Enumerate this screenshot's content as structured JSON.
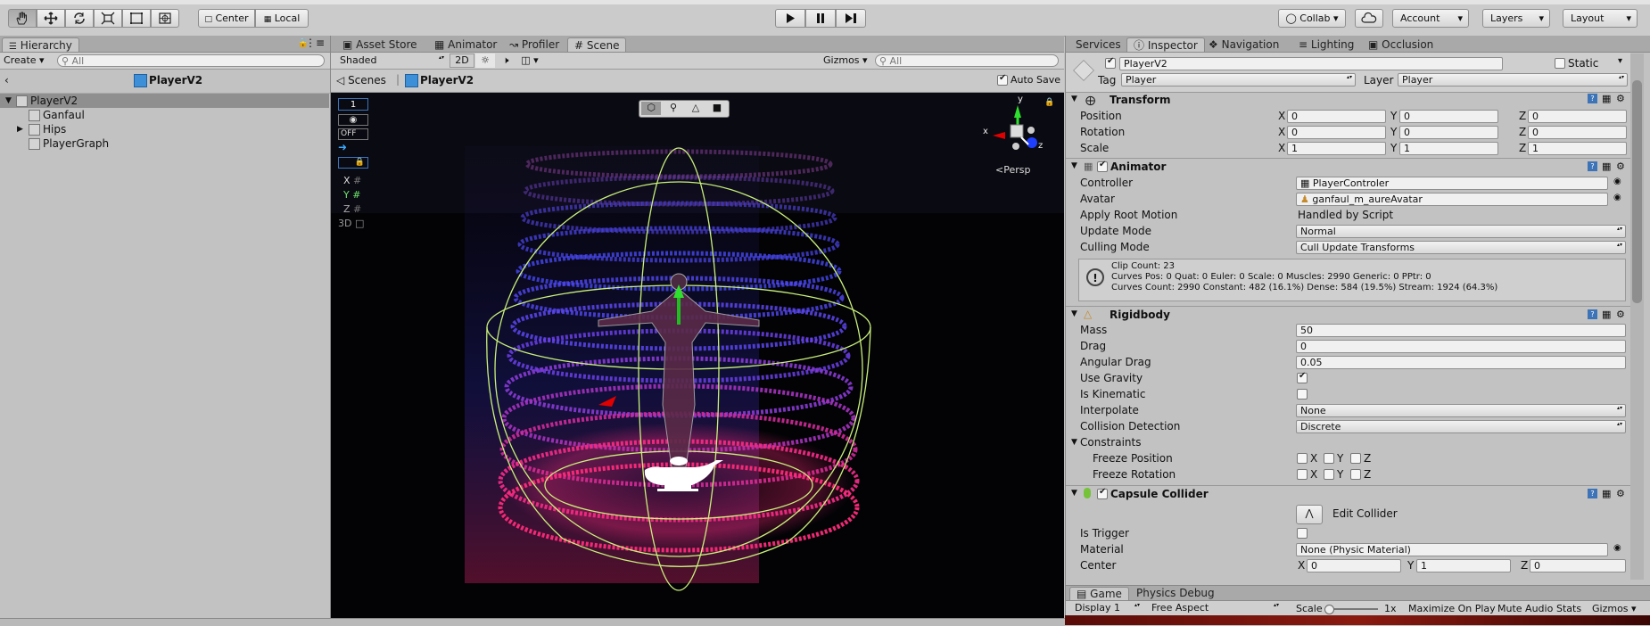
{
  "toolbar": {
    "pivot_label": "Center",
    "space_label": "Local",
    "collab_label": "Collab",
    "account_label": "Account",
    "layers_label": "Layers",
    "layout_label": "Layout"
  },
  "hierarchy": {
    "tab_label": "Hierarchy",
    "create_label": "Create",
    "search_placeholder": " All",
    "scene_title": "PlayerV2",
    "items": [
      {
        "label": "PlayerV2",
        "depth": 0,
        "selected": true,
        "expanded": true
      },
      {
        "label": "Ganfaul",
        "depth": 1
      },
      {
        "label": "Hips",
        "depth": 1,
        "collapsed": true
      },
      {
        "label": "PlayerGraph",
        "depth": 1
      }
    ]
  },
  "scene": {
    "tabs": [
      "Asset Store",
      "Animator",
      "Profiler",
      "Scene"
    ],
    "active_tab": "Scene",
    "shading_mode": "Shaded",
    "mode_2d": "2D",
    "gizmos_label": "Gizmos",
    "search_placeholder": " All",
    "breadcrumb_scenes": "Scenes",
    "breadcrumb_prefab": "PlayerV2",
    "auto_save_label": "Auto Save",
    "auto_save_checked": true,
    "layer_field": "1",
    "off_label": "OFF",
    "axis_x": "X",
    "axis_y": "Y",
    "axis_z": "Z",
    "label_3d": "3D",
    "persp_label": "Persp",
    "gizmo_y": "y",
    "gizmo_x": "x",
    "gizmo_z": "z"
  },
  "inspector": {
    "tabs": [
      "Services",
      "Inspector",
      "Navigation",
      "Lighting",
      "Occlusion"
    ],
    "active_tab": "Inspector",
    "object_name": "PlayerV2",
    "static_label": "Static",
    "tag_label": "Tag",
    "tag_value": "Player",
    "layer_label": "Layer",
    "layer_value": "Player",
    "transform": {
      "title": "Transform",
      "position_label": "Position",
      "rotation_label": "Rotation",
      "scale_label": "Scale",
      "position": {
        "x": "0",
        "y": "0",
        "z": "0"
      },
      "rotation": {
        "x": "0",
        "y": "0",
        "z": "0"
      },
      "scale": {
        "x": "1",
        "y": "1",
        "z": "1"
      }
    },
    "animator": {
      "title": "Animator",
      "controller_label": "Controller",
      "controller_value": "PlayerControler",
      "avatar_label": "Avatar",
      "avatar_value": "ganfaul_m_aureAvatar",
      "apply_root_motion_label": "Apply Root Motion",
      "apply_root_motion_value": "Handled by Script",
      "update_mode_label": "Update Mode",
      "update_mode_value": "Normal",
      "culling_mode_label": "Culling Mode",
      "culling_mode_value": "Cull Update Transforms",
      "info_line1": "Clip Count: 23",
      "info_line2": "Curves Pos: 0 Quat: 0 Euler: 0 Scale: 0 Muscles: 2990 Generic: 0 PPtr: 0",
      "info_line3": "Curves Count: 2990 Constant: 482 (16.1%) Dense: 584 (19.5%) Stream: 1924 (64.3%)"
    },
    "rigidbody": {
      "title": "Rigidbody",
      "mass_label": "Mass",
      "mass_value": "50",
      "drag_label": "Drag",
      "drag_value": "0",
      "angular_drag_label": "Angular Drag",
      "angular_drag_value": "0.05",
      "use_gravity_label": "Use Gravity",
      "use_gravity": true,
      "is_kinematic_label": "Is Kinematic",
      "is_kinematic": false,
      "interpolate_label": "Interpolate",
      "interpolate_value": "None",
      "collision_detection_label": "Collision Detection",
      "collision_detection_value": "Discrete",
      "constraints_label": "Constraints",
      "freeze_position_label": "Freeze Position",
      "freeze_rotation_label": "Freeze Rotation"
    },
    "capsule_collider": {
      "title": "Capsule Collider",
      "edit_collider_label": "Edit Collider",
      "is_trigger_label": "Is Trigger",
      "material_label": "Material",
      "material_value": "None (Physic Material)",
      "center_label": "Center",
      "center": {
        "x": "0",
        "y": "1",
        "z": "0"
      }
    }
  },
  "game": {
    "tabs": [
      "Game",
      "Physics Debug"
    ],
    "active_tab": "Game",
    "display_value": "Display 1",
    "aspect_value": "Free Aspect",
    "scale_label": "Scale",
    "scale_value": "1x",
    "maximize_label": "Maximize On Play",
    "mute_label": "Mute Audio",
    "stats_label": "Stats",
    "gizmos_label": "Gizmos"
  },
  "colors": {
    "accent_blue": "#3d74b8",
    "selection": "#8f8f8f",
    "scene_bg": "#050508",
    "effect_pink": "#ff2a7a",
    "effect_blue": "#3f3cff"
  }
}
